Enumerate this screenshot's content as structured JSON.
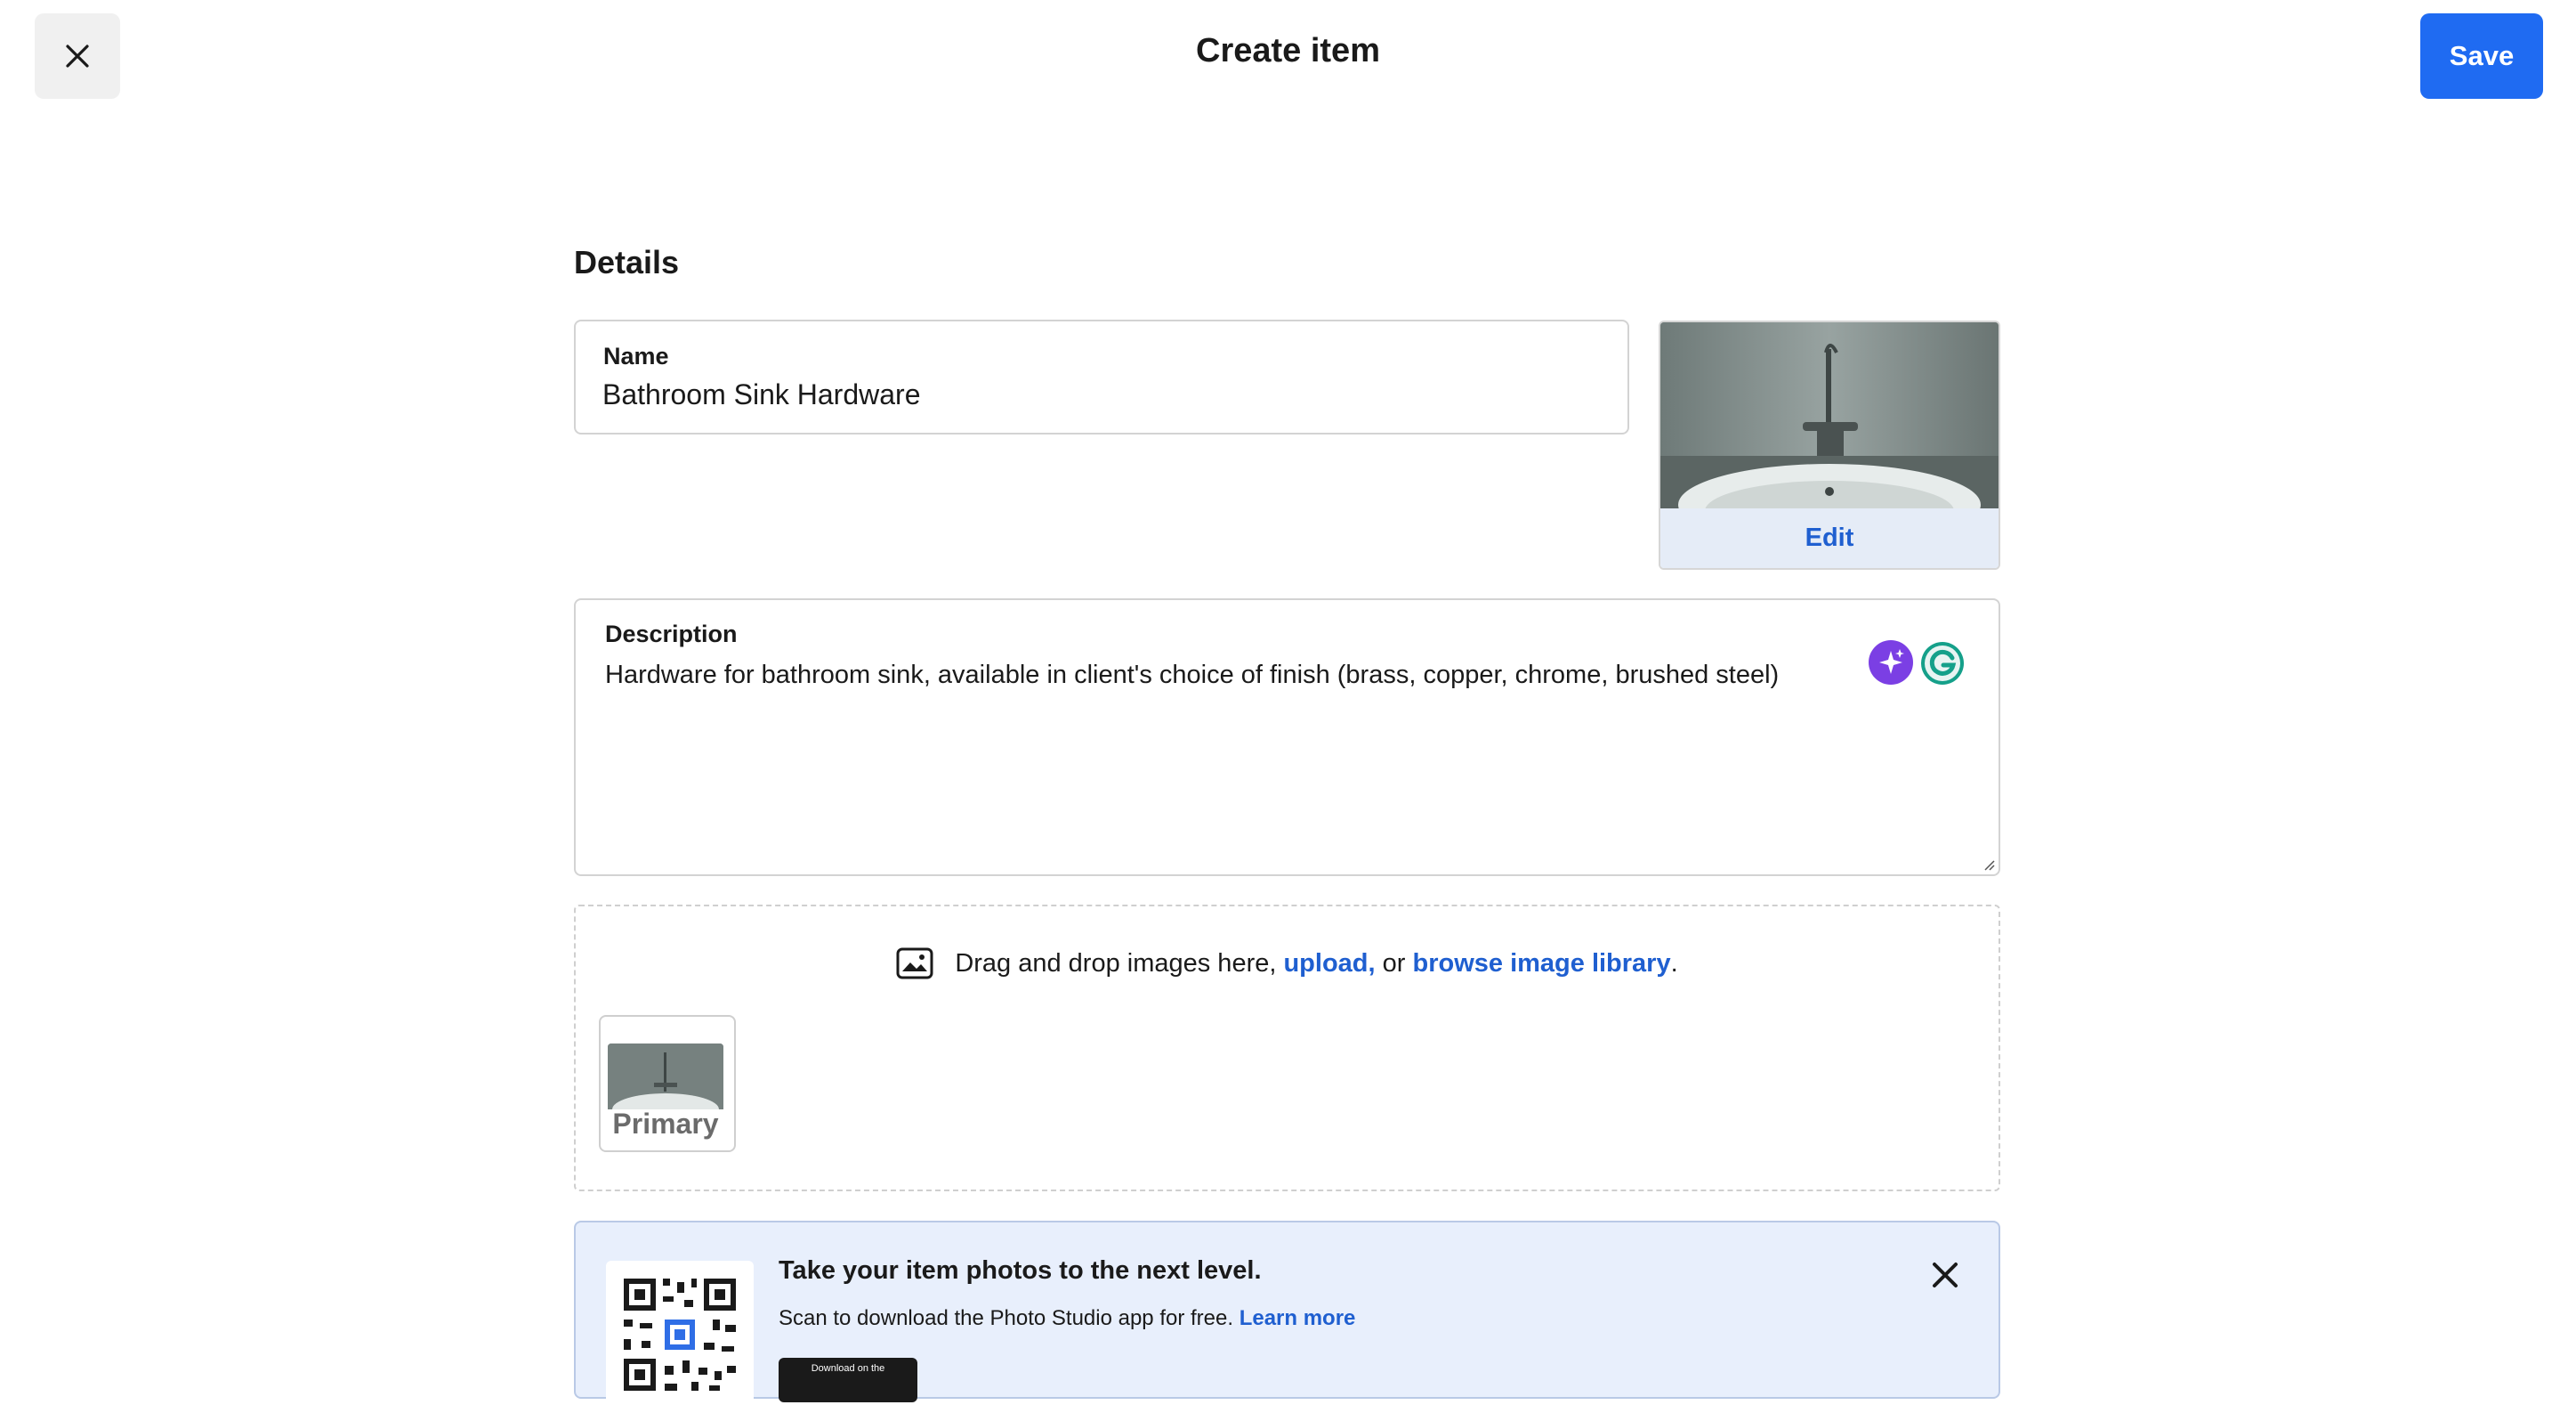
{
  "header": {
    "title": "Create item",
    "save_label": "Save"
  },
  "details": {
    "section_title": "Details",
    "name_label": "Name",
    "name_value": "Bathroom Sink Hardware",
    "image_edit_label": "Edit",
    "description_label": "Description",
    "description_value": "Hardware for bathroom sink, available in client's choice of finish (brass, copper, chrome, brushed steel)"
  },
  "images": {
    "drop_text": "Drag and drop images here, ",
    "upload_link": "upload,",
    "or_text": " or ",
    "browse_link": "browse image library",
    "period": ".",
    "primary_label": "Primary"
  },
  "promo": {
    "title": "Take your item photos to the next level.",
    "subtitle": "Scan to download the Photo Studio app for free. ",
    "learn_more": "Learn more",
    "badge_text": "Download on the"
  },
  "colors": {
    "accent": "#1f6bf2",
    "link": "#1f5fd0",
    "ai_assist": "#7b3fe4",
    "promo_bg": "#e8effc"
  },
  "icons": [
    "close-icon",
    "ai-sparkle-icon",
    "grammarly-icon",
    "image-icon",
    "qr-code",
    "resize-grip-icon"
  ]
}
